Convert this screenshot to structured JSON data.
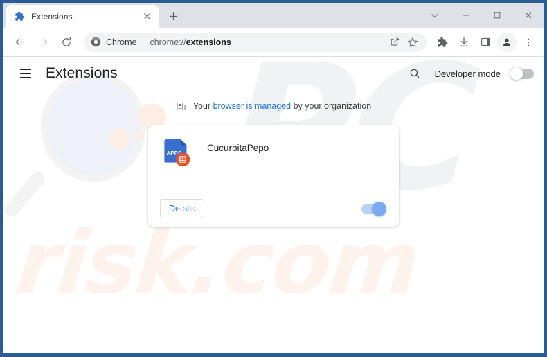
{
  "window": {
    "caption_buttons": [
      {
        "name": "tab-search",
        "label": "⌄"
      },
      {
        "name": "minimize",
        "label": "–"
      },
      {
        "name": "maximize",
        "label": "□"
      },
      {
        "name": "close",
        "label": "✕"
      }
    ]
  },
  "tab": {
    "title": "Extensions",
    "favicon": "puzzle-piece-icon",
    "close_label": "✕",
    "new_tab_label": "+"
  },
  "toolbar": {
    "back_label": "←",
    "forward_label": "→",
    "reload_label": "↻",
    "chrome_badge_label": "Chrome",
    "url_prefix": "chrome://",
    "url_suffix": "extensions",
    "share_icon": "share-icon",
    "bookmark_icon": "star-icon",
    "extensions_icon": "puzzle-piece-icon",
    "downloads_icon": "download-icon",
    "sidepanel_icon": "side-panel-icon",
    "profile_icon": "profile-avatar-icon",
    "menu_label": "⋮"
  },
  "page": {
    "title": "Extensions",
    "menu_icon": "hamburger-menu-icon",
    "search_icon": "search-icon",
    "developer_mode_label": "Developer mode",
    "developer_mode_on": false,
    "managed": {
      "icon": "building-icon",
      "prefix": "Your ",
      "link": "browser is managed",
      "suffix": " by your organization"
    },
    "extensions": [
      {
        "name": "CucurbitaPepo",
        "icon_label": "APPS",
        "icon_badge": "spreadsheet-badge-icon",
        "details_label": "Details",
        "enabled": true
      }
    ]
  },
  "colors": {
    "accent_blue": "#1a73e8",
    "window_frame": "#2b5c96",
    "tabstrip_bg": "#dee1e6",
    "omnibox_bg": "#f1f3f4",
    "icon_blue": "#3a6ed0",
    "badge_orange": "#e8532a",
    "toggle_on": "#7aabf0",
    "watermark_pc": "#f1f2f3",
    "watermark_risk": "#fdf2ec"
  },
  "watermark": {
    "primary": "PC",
    "secondary": "risk.com",
    "glass": "magnifying-glass-watermark"
  }
}
